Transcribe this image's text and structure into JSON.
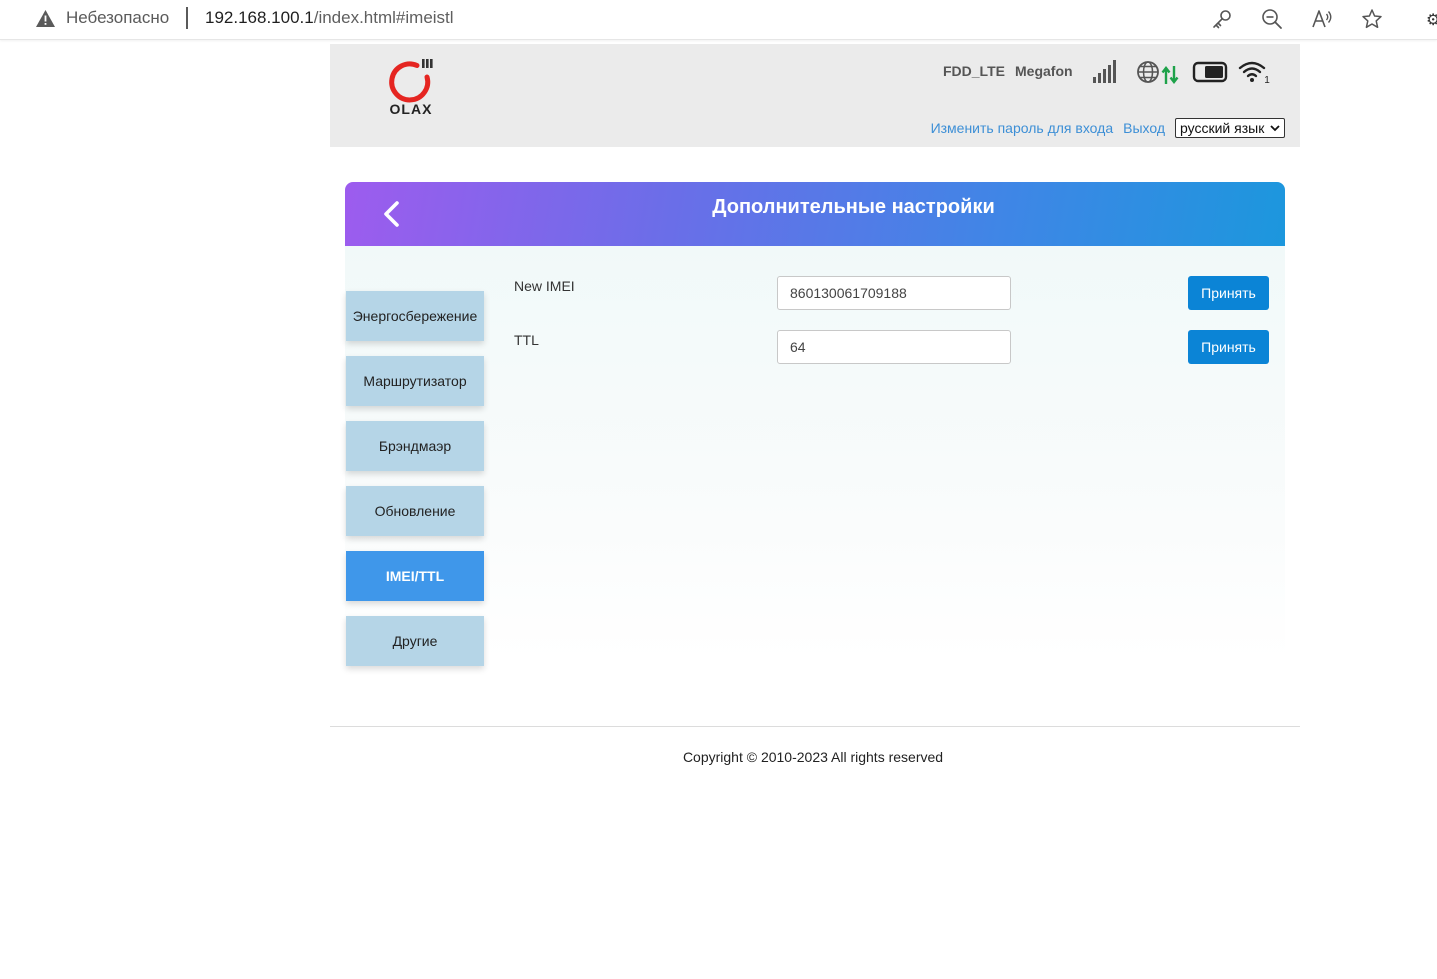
{
  "browser": {
    "security_label": "Небезопасно",
    "url_host": "192.168.100.1",
    "url_path": "/index.html#imeistl",
    "icons": [
      "warning-icon",
      "key-icon",
      "zoom-out-icon",
      "read-aloud-icon",
      "favorite-star-icon",
      "extensions-icon"
    ]
  },
  "header": {
    "logo_text": "OLAX",
    "network_type": "FDD_LTE",
    "operator": "Megafon",
    "icons": [
      "signal-strength-icon",
      "globe-internet-icon",
      "data-transfer-arrows-icon",
      "battery-icon",
      "wifi-icon"
    ],
    "wifi_clients": "1",
    "change_password_link": "Изменить пароль для входа",
    "logout_link": "Выход",
    "language_selected": "русский язык",
    "colors": {
      "background": "#ebebeb",
      "link": "#3d8fd6",
      "logo_red": "#e52521",
      "data_green": "#1ea24a"
    }
  },
  "page": {
    "title": "Дополнительные настройки",
    "banner_gradient": [
      "#9d5cee",
      "#1c97dd"
    ]
  },
  "menu": {
    "items": [
      {
        "label": "Энергосбережение",
        "active": false
      },
      {
        "label": "Маршрутизатор",
        "active": false
      },
      {
        "label": "Брэндмаэр",
        "active": false
      },
      {
        "label": "Обновление",
        "active": false
      },
      {
        "label": "IMEI/TTL",
        "active": true
      },
      {
        "label": "Другие",
        "active": false
      }
    ],
    "colors": {
      "item": "#b5d5e7",
      "active": "#3f97ea"
    }
  },
  "form": {
    "imei": {
      "label": "New IMEI",
      "value": "860130061709188",
      "button": "Принять"
    },
    "ttl": {
      "label": "TTL",
      "value": "64",
      "button": "Принять"
    },
    "button_color": "#0b84d6"
  },
  "footer": {
    "copyright": "Copyright © 2010-2023 All rights reserved"
  }
}
